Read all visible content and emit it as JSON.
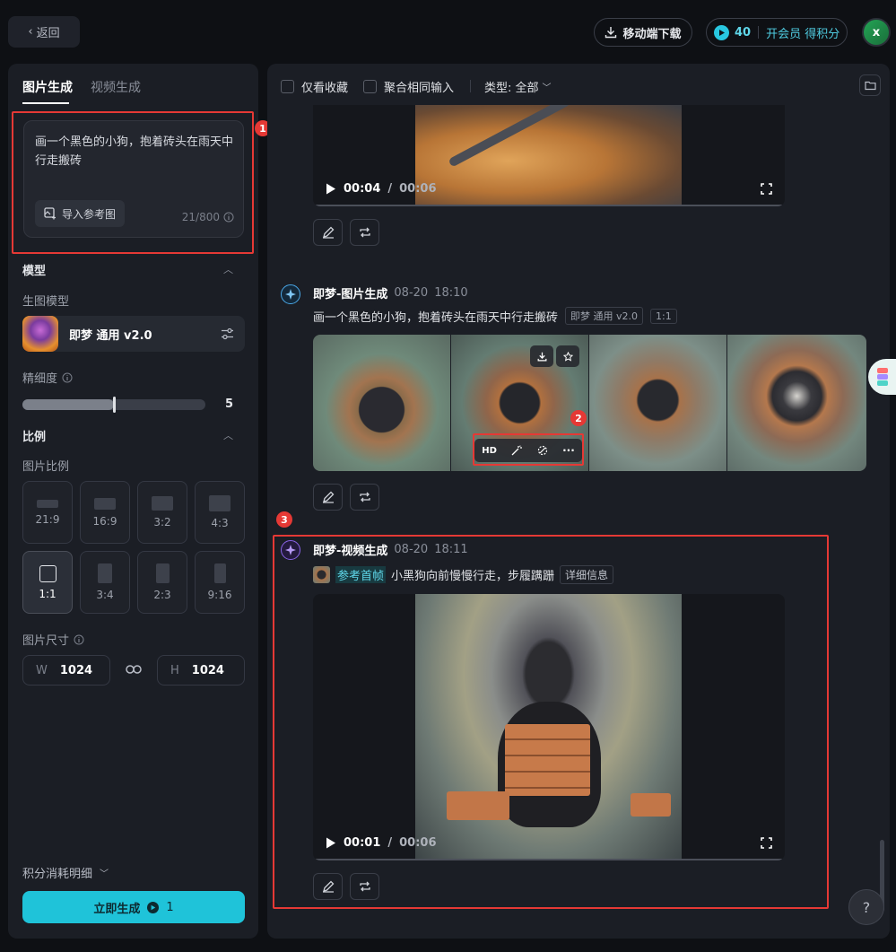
{
  "topbar": {
    "back_label": "返回",
    "download_label": "移动端下载",
    "credits": "40",
    "vip_label": "开会员 得积分",
    "avatar_letter": "x"
  },
  "sidebar": {
    "tabs": [
      "图片生成",
      "视频生成"
    ],
    "prompt": "画一个黑色的小狗，抱着砖头在雨天中行走搬砖",
    "import_label": "导入参考图",
    "char_count": "21/800",
    "model_section": "模型",
    "gen_model_label": "生图模型",
    "model_name": "即梦 通用 v2.0",
    "detail_label": "精细度",
    "detail_value": "5",
    "detail_level": 0.5,
    "ratio_section": "比例",
    "image_ratio_label": "图片比例",
    "ratios": [
      "21:9",
      "16:9",
      "3:2",
      "4:3",
      "1:1",
      "3:4",
      "2:3",
      "9:16"
    ],
    "selected_ratio": "1:1",
    "size_label": "图片尺寸",
    "width_key": "W",
    "width_value": "1024",
    "height_key": "H",
    "height_value": "1024",
    "cost_label": "积分消耗明细",
    "generate_label": "立即生成",
    "generate_cost": "1"
  },
  "main": {
    "fav_only_label": "仅看收藏",
    "merge_label": "聚合相同输入",
    "type_filter": "类型: 全部",
    "video1": {
      "time": "00:04",
      "duration": "00:06"
    },
    "image_entry": {
      "title": "即梦-图片生成",
      "date": "08-20",
      "time": "18:10",
      "prompt": "画一个黑色的小狗，抱着砖头在雨天中行走搬砖",
      "model_tag": "即梦 通用 v2.0",
      "ratio_tag": "1:1",
      "hd_label": "HD"
    },
    "video_entry": {
      "title": "即梦-视频生成",
      "date": "08-20",
      "time": "18:11",
      "ref_label": "参考首帧",
      "prompt": "小黑狗向前慢慢行走，步履蹒跚",
      "detail_label": "详细信息",
      "time_current": "00:01",
      "duration": "00:06"
    }
  },
  "annotations": [
    "1",
    "2",
    "3"
  ],
  "help_label": "?",
  "colors": {
    "accent": "#1fc3d9",
    "annotation_red": "#e53935",
    "panel": "#1b1e25"
  }
}
